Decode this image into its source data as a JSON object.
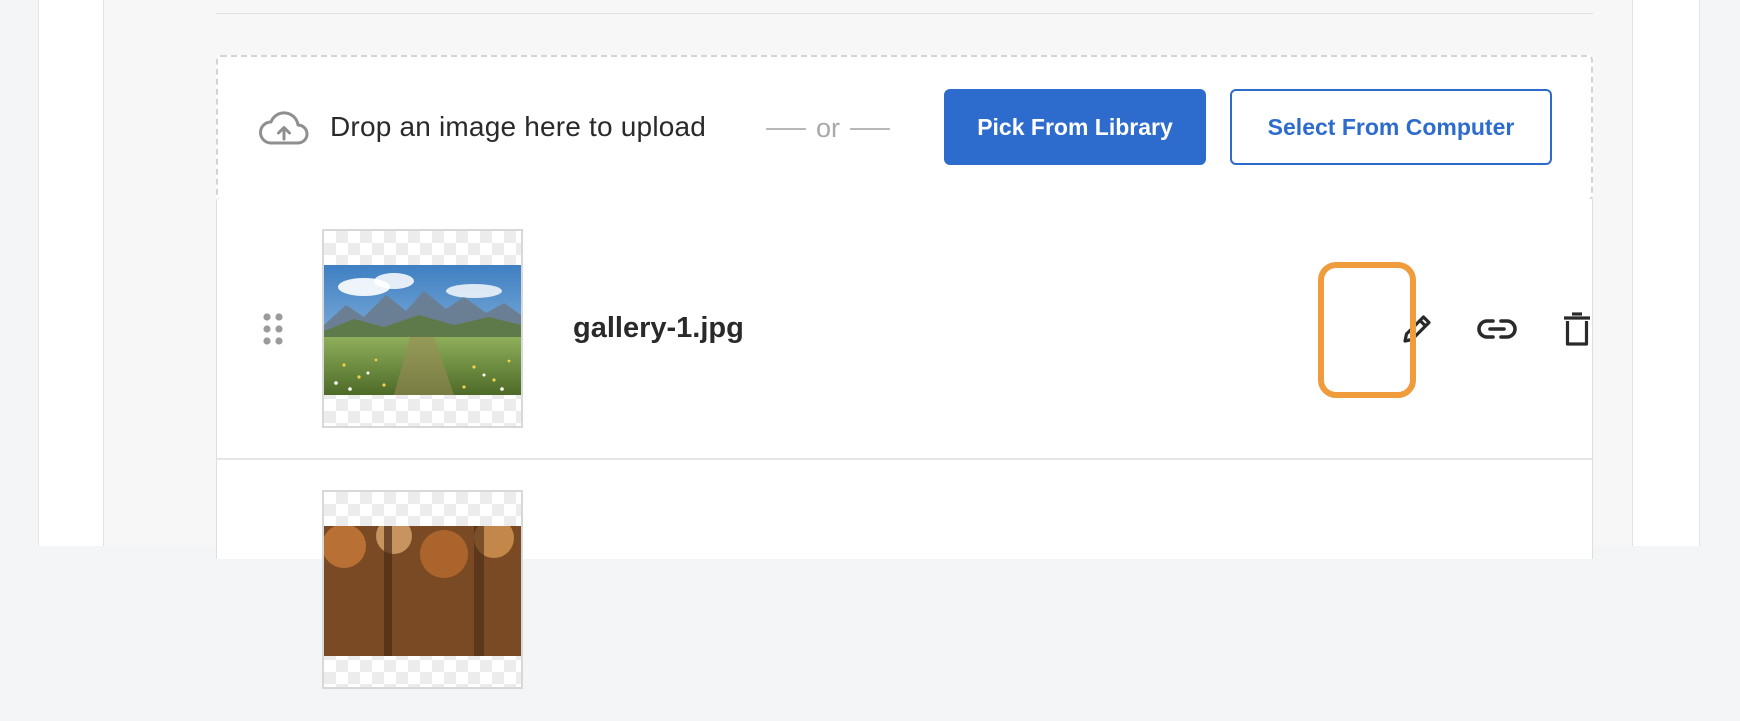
{
  "uploader": {
    "drop_text": "Drop an image here to upload",
    "or_text": "or",
    "pick_library_label": "Pick From Library",
    "select_computer_label": "Select From Computer",
    "icon": "cloud-upload-icon"
  },
  "images": [
    {
      "file_name": "gallery-1.jpg",
      "thumbnail": "mountain-meadow"
    },
    {
      "file_name": "",
      "thumbnail": "autumn-bokeh"
    }
  ],
  "actions": [
    {
      "name": "edit",
      "icon": "pencil-icon"
    },
    {
      "name": "copy-link",
      "icon": "link-icon"
    },
    {
      "name": "delete",
      "icon": "trash-icon"
    }
  ],
  "colors": {
    "accent": "#2d6ccd",
    "focus_ring": "#f09b3c",
    "text": "#2a2a2a",
    "muted": "#a9a9a9"
  }
}
